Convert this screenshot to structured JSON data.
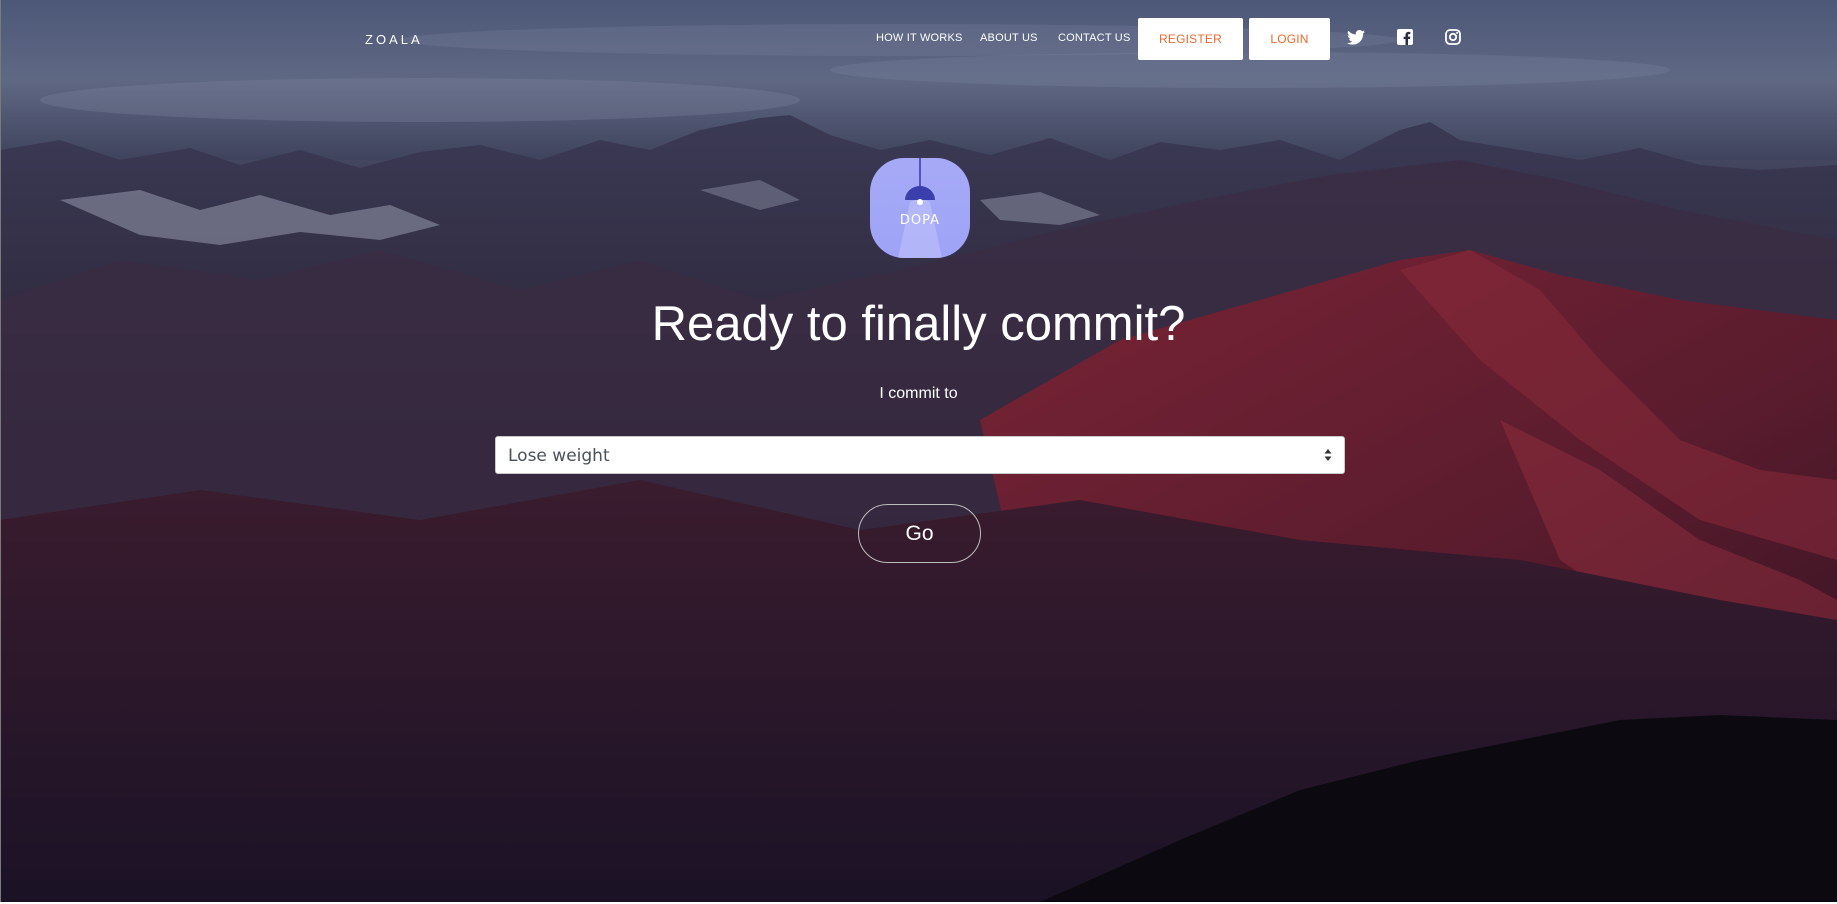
{
  "nav": {
    "brand": "ZOALA",
    "links": [
      "HOW IT WORKS",
      "ABOUT US",
      "CONTACT US"
    ],
    "register_label": "REGISTER",
    "login_label": "LOGIN",
    "social_icons": [
      "twitter-icon",
      "facebook-icon",
      "instagram-icon"
    ]
  },
  "logo": {
    "text": "DOPA",
    "icon": "lamp-icon",
    "background": "#a6aaf6"
  },
  "main": {
    "headline": "Ready to finally commit?",
    "commit_label": "I commit to",
    "select_value": "Lose weight",
    "go_label": "Go"
  },
  "colors": {
    "accent": "#e86a2e",
    "text": "#ffffff"
  }
}
